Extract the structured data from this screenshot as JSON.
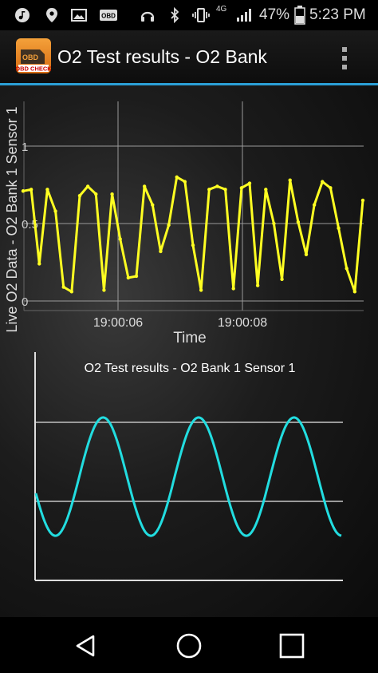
{
  "status_bar": {
    "network": "4G",
    "battery": "47%",
    "time": "5:23 PM",
    "icons": [
      "music-icon",
      "location-icon",
      "image-icon",
      "obd-icon",
      "headset-icon",
      "bluetooth-icon",
      "vibrate-icon",
      "network-icon",
      "signal-icon",
      "battery-icon"
    ]
  },
  "app_bar": {
    "logo_label": "OBD CHECK",
    "logo_badge": "OBD",
    "title": "O2 Test results - O2 Bank",
    "menu_icon": "overflow-menu-icon"
  },
  "colors": {
    "accent": "#2b9fd6",
    "live_series": "#ffff22",
    "sine_series": "#22dde0",
    "grid": "#9a9a9a"
  },
  "chart_data": [
    {
      "type": "line",
      "title": "",
      "xlabel": "Time",
      "ylabel": "Live O2 Data - O2 Bank 1 Sensor 1",
      "x_tick_labels": [
        "19:00:06",
        "19:00:08"
      ],
      "y_tick_labels": [
        "0",
        "0.5",
        "1"
      ],
      "ylim": [
        0,
        1.3
      ],
      "grid": true,
      "series": [
        {
          "values": [
            0.71,
            0.72,
            0.24,
            0.72,
            0.58,
            0.09,
            0.06,
            0.68,
            0.74,
            0.69,
            0.07,
            0.69,
            0.4,
            0.15,
            0.16,
            0.74,
            0.62,
            0.32,
            0.49,
            0.8,
            0.77,
            0.36,
            0.07,
            0.72,
            0.74,
            0.72,
            0.08,
            0.73,
            0.76,
            0.1,
            0.72,
            0.5,
            0.14,
            0.78,
            0.51,
            0.3,
            0.62,
            0.77,
            0.73,
            0.47,
            0.21,
            0.06,
            0.65
          ]
        }
      ]
    },
    {
      "type": "line",
      "title": "O2 Test results - O2 Bank 1 Sensor 1",
      "xlabel": "",
      "ylabel": "",
      "ylim": [
        0,
        1
      ],
      "grid": true,
      "grid_values": [
        0.45,
        0.9
      ],
      "series": [
        {
          "function": "sine",
          "cycles": 3.2,
          "min": 0.25,
          "max": 1.2,
          "start_value": 0.5
        }
      ]
    }
  ],
  "nav_bar": {
    "back": "back-icon",
    "home": "home-icon",
    "recents": "recents-icon"
  }
}
